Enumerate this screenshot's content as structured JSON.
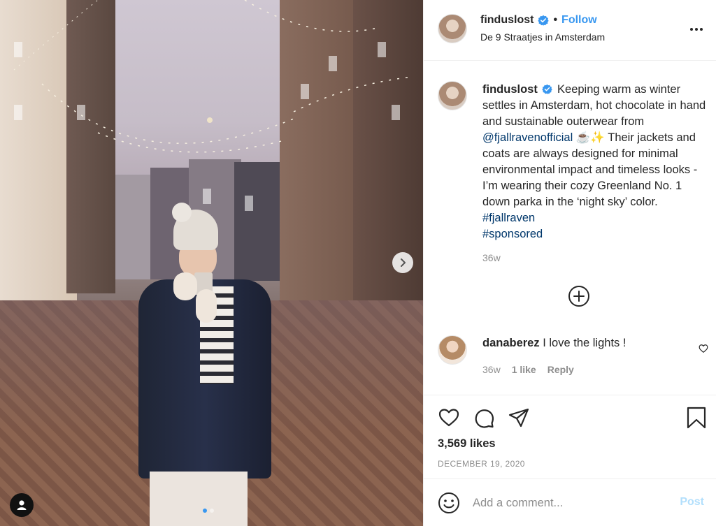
{
  "post": {
    "username": "finduslost",
    "follow_label": "Follow",
    "separator": "•",
    "location": "De 9 Straatjes in Amsterdam",
    "caption": {
      "username": "finduslost",
      "text_1": "Keeping warm as winter settles in Amsterdam, hot chocolate in hand and sustainable outerwear from ",
      "mention": "@fjallravenofficial",
      "emoji": " ☕✨ ",
      "text_2": "Their jackets and coats are always designed for minimal environmental impact and timeless looks - I’m wearing their cozy Greenland No. 1 down parka in the ‘night sky’ color. ",
      "hashtag_1": "#fjallraven",
      "hashtag_2": "#sponsored",
      "time": "36w"
    },
    "comment": {
      "username": "danaberez",
      "text": "I love the lights !",
      "time": "36w",
      "likes": "1 like",
      "reply_label": "Reply"
    },
    "likes": "3,569 likes",
    "date": "DECEMBER 19, 2020",
    "add_comment_placeholder": "Add a comment...",
    "post_label": "Post"
  },
  "carousel": {
    "current_index": 1,
    "total": 2
  },
  "icons": {
    "verified": "verified-badge-icon",
    "more": "more-options-icon",
    "load_more": "plus-circle-icon",
    "like": "heart-icon",
    "comment": "comment-icon",
    "share": "share-icon",
    "save": "bookmark-icon",
    "emoji": "emoji-icon",
    "next": "chevron-right-icon",
    "tags": "user-tag-icon"
  },
  "colors": {
    "link": "#00376b",
    "follow": "#3897f0",
    "secondary": "#8e8e8e",
    "post_disabled": "#b2dffc"
  }
}
